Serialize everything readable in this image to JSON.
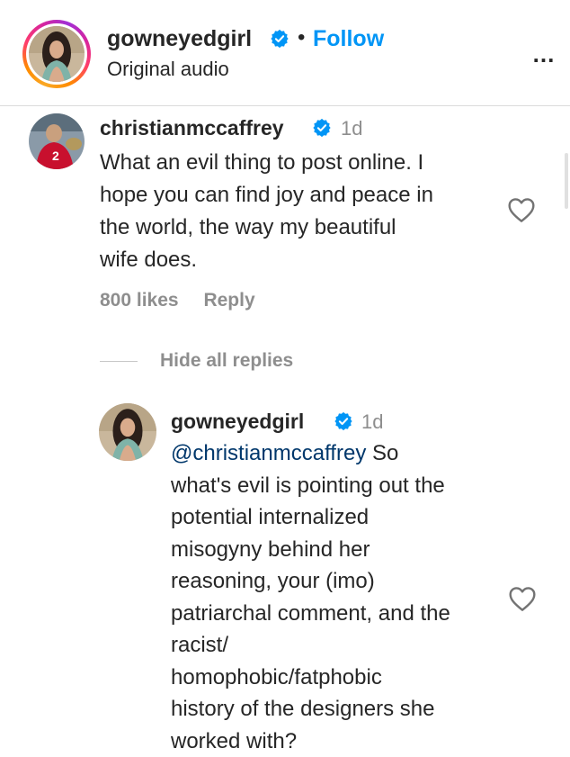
{
  "header": {
    "username": "gowneyedgirl",
    "separator": "•",
    "follow_label": "Follow",
    "audio": "Original audio",
    "more_label": "..."
  },
  "comment": {
    "username": "christianmccaffrey",
    "time": "1d",
    "lines": [
      "What an evil thing to post online. I",
      "hope you can find joy and peace in",
      "the world, the way my beautiful",
      "wife does."
    ],
    "likes": "800 likes",
    "reply_label": "Reply"
  },
  "hide_replies_label": "Hide all replies",
  "reply": {
    "username": "gowneyedgirl",
    "time": "1d",
    "mention": "@christianmccaffrey",
    "first_line_rest": " So",
    "lines": [
      "what's evil is pointing out the",
      "potential internalized",
      "misogyny behind her",
      "reasoning, your (imo)",
      "patriarchal comment, and the",
      "racist/",
      "homophobic/fatphobic",
      "history of the designers she",
      "worked with?"
    ]
  },
  "colors": {
    "link_blue": "#0095f6",
    "mention_blue": "#00376b",
    "verified_blue": "#0095f6",
    "secondary_gray": "#8e8e8e"
  },
  "icons": {
    "verified": "verified-badge-icon",
    "heart": "heart-outline-icon",
    "more": "more-horizontal-icon"
  }
}
